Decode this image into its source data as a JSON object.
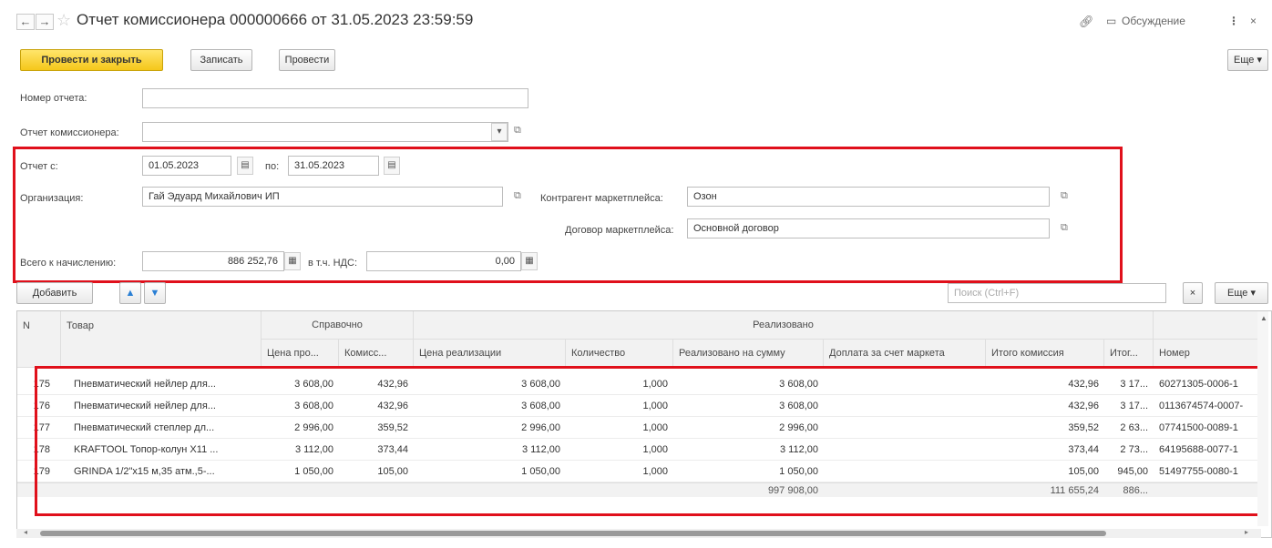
{
  "window": {
    "title": "Отчет комиссионера 000000666 от 31.05.2023 23:59:59",
    "discussion_label": "Обсуждение",
    "more_dots": "⋮",
    "close": "×"
  },
  "toolbar": {
    "post_close": "Провести и закрыть",
    "save": "Записать",
    "post": "Провести",
    "more": "Еще ▾"
  },
  "form": {
    "report_number_label": "Номер отчета:",
    "report_number_value": "",
    "commissioner_report_label": "Отчет комиссионера:",
    "commissioner_report_value": "",
    "period_from_label": "Отчет с:",
    "period_from_value": "01.05.2023",
    "period_to_label": "по:",
    "period_to_value": "31.05.2023",
    "organization_label": "Организация:",
    "organization_value": "Гай Эдуард Михайлович ИП",
    "marketplace_contractor_label": "Контрагент маркетплейса:",
    "marketplace_contractor_value": "Озон",
    "marketplace_contract_label": "Договор маркетплейса:",
    "marketplace_contract_value": "Основной договор",
    "total_accrual_label": "Всего к начислению:",
    "total_accrual_value": "886 252,76",
    "vat_label": "в т.ч. НДС:",
    "vat_value": "0,00"
  },
  "table_toolbar": {
    "add": "Добавить",
    "up": "▲",
    "down": "▼",
    "search_placeholder": "Поиск (Ctrl+F)",
    "clear": "×",
    "more": "Еще ▾"
  },
  "table": {
    "group_headers": {
      "reference": "Справочно",
      "sold": "Реализовано"
    },
    "headers": {
      "n": "N",
      "product": "Товар",
      "price_sale": "Цена про...",
      "commission": "Комисс...",
      "sale_price": "Цена реализации",
      "quantity": "Количество",
      "sold_amount": "Реализовано на сумму",
      "marketplace_surcharge": "Доплата за счет маркета",
      "total_commission": "Итого комиссия",
      "total": "Итог...",
      "number": "Номер"
    },
    "rows": [
      {
        "n": "175",
        "product": "Пневматический нейлер для...",
        "price_sale": "3 608,00",
        "commission": "432,96",
        "sale_price": "3 608,00",
        "quantity": "1,000",
        "sold_amount": "3 608,00",
        "marketplace_surcharge": "",
        "total_commission": "432,96",
        "total": "3 17...",
        "number": "60271305-0006-1"
      },
      {
        "n": "176",
        "product": "Пневматический нейлер для...",
        "price_sale": "3 608,00",
        "commission": "432,96",
        "sale_price": "3 608,00",
        "quantity": "1,000",
        "sold_amount": "3 608,00",
        "marketplace_surcharge": "",
        "total_commission": "432,96",
        "total": "3 17...",
        "number": "0113674574-0007-"
      },
      {
        "n": "177",
        "product": "Пневматический степлер дл...",
        "price_sale": "2 996,00",
        "commission": "359,52",
        "sale_price": "2 996,00",
        "quantity": "1,000",
        "sold_amount": "2 996,00",
        "marketplace_surcharge": "",
        "total_commission": "359,52",
        "total": "2 63...",
        "number": "07741500-0089-1"
      },
      {
        "n": "178",
        "product": "KRAFTOOL Топор-колун X11 ...",
        "price_sale": "3 112,00",
        "commission": "373,44",
        "sale_price": "3 112,00",
        "quantity": "1,000",
        "sold_amount": "3 112,00",
        "marketplace_surcharge": "",
        "total_commission": "373,44",
        "total": "2 73...",
        "number": "64195688-0077-1"
      },
      {
        "n": "179",
        "product": "GRINDA 1/2\"x15 м,35 атм.,5-...",
        "price_sale": "1 050,00",
        "commission": "105,00",
        "sale_price": "1 050,00",
        "quantity": "1,000",
        "sold_amount": "1 050,00",
        "marketplace_surcharge": "",
        "total_commission": "105,00",
        "total": "945,00",
        "number": "51497755-0080-1"
      }
    ],
    "footer": {
      "sold_amount": "997 908,00",
      "total_commission": "111 655,24",
      "total": "886..."
    }
  },
  "colors": {
    "highlight": "#e0101b",
    "primary_button": "#f5c71a"
  }
}
